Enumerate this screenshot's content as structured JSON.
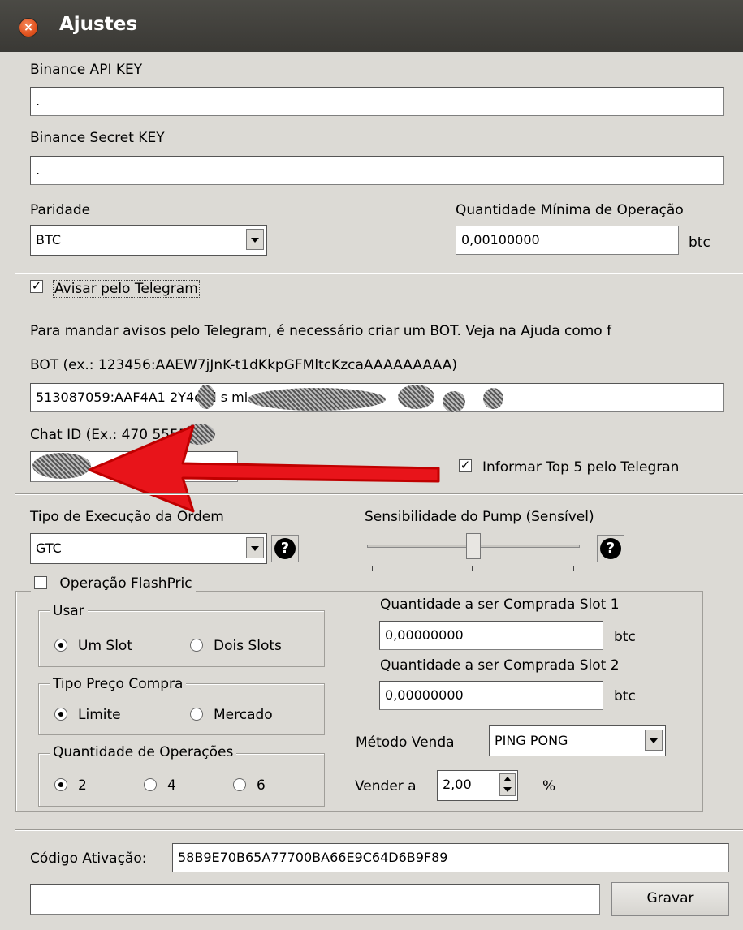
{
  "window": {
    "title": "Ajustes",
    "close_glyph": "×"
  },
  "api": {
    "api_key_label": "Binance API KEY",
    "api_key_value": ".",
    "secret_label": "Binance Secret KEY",
    "secret_value": "."
  },
  "parity": {
    "label": "Paridade",
    "selected": "BTC",
    "min_label": "Quantidade Mínima de Operação",
    "min_value": "0,00100000",
    "min_unit": "btc"
  },
  "telegram": {
    "notify_label": "Avisar pelo Telegram",
    "notify_checked": true,
    "info": "Para mandar avisos pelo Telegram, é necessário criar um BOT. Veja na Ajuda como f",
    "bot_label": "BOT (ex.: 123456:AAEW7jJnK-t1dKkpGFMltcKzcaAAAAAAAAA)",
    "bot_value": "513087059:AAF4A1  2Y4ck                         l    s  mi",
    "chat_label": "Chat ID (Ex.: 470  55555)",
    "chat_value": "  ",
    "top5_label": "Informar Top 5 pelo Telegran",
    "top5_checked": true
  },
  "execution": {
    "label": "Tipo de Execução da Ordem",
    "selected": "GTC",
    "help_glyph": "?",
    "pump_label": "Sensibilidade do Pump (Sensível)",
    "pump_level": 0.5
  },
  "flash": {
    "label": "Operação FlashPric",
    "usar": {
      "title": "Usar",
      "opt1": "Um Slot",
      "opt2": "Dois Slots",
      "selected": "Um Slot"
    },
    "preco": {
      "title": "Tipo Preço Compra",
      "opt1": "Limite",
      "opt2": "Mercado",
      "selected": "Limite"
    },
    "qtd": {
      "title": "Quantidade de Operações",
      "opt1": "2",
      "opt2": "4",
      "opt3": "6",
      "selected": "2"
    },
    "slot1_label": "Quantidade a ser Comprada Slot 1",
    "slot1_value": "0,00000000",
    "slot1_unit": "btc",
    "slot2_label": "Quantidade a ser Comprada Slot 2",
    "slot2_value": "0,00000000",
    "slot2_unit": "btc",
    "metodo_label": "Método Venda",
    "metodo_value": "PING PONG",
    "vender_label": "Vender a",
    "vender_value": "2,00",
    "vender_unit": "%"
  },
  "activation": {
    "label": "Código Ativação:",
    "value": "58B9E70B65A77700BA66E9C64D6B9F89",
    "status_value": "",
    "save_label": "Gravar"
  },
  "colors": {
    "arrow": "#e8141a",
    "titlebar": "#3f3e3a",
    "close": "#e2531f"
  }
}
